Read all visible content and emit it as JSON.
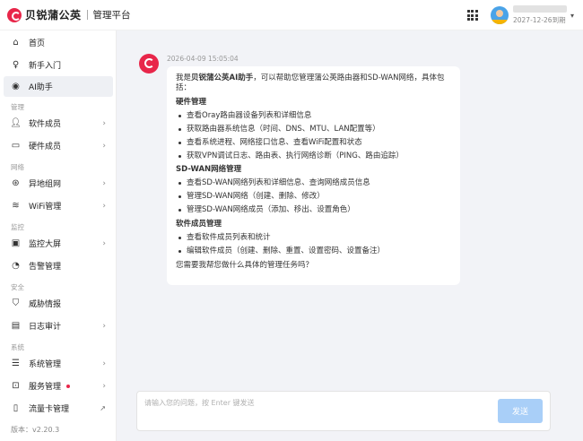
{
  "header": {
    "brand_name": "贝锐蒲公英",
    "brand_sub": "管理平台",
    "user_expire": "2027-12-26到期"
  },
  "sidebar": {
    "items": [
      {
        "label": "首页",
        "icon": "home-icon"
      },
      {
        "label": "新手入门",
        "icon": "bulb-icon"
      },
      {
        "label": "AI助手",
        "icon": "ai-icon"
      }
    ],
    "groups": {
      "manage": "管理",
      "network": "网络",
      "monitor": "监控",
      "security": "安全",
      "system": "系统"
    },
    "manage_items": [
      {
        "label": "软件成员"
      },
      {
        "label": "硬件成员"
      }
    ],
    "network_items": [
      {
        "label": "异地组网"
      },
      {
        "label": "WiFi管理"
      }
    ],
    "monitor_items": [
      {
        "label": "监控大屏"
      },
      {
        "label": "告警管理"
      }
    ],
    "security_items": [
      {
        "label": "威胁情报"
      },
      {
        "label": "日志审计"
      }
    ],
    "system_items": [
      {
        "label": "系统管理"
      },
      {
        "label": "服务管理"
      },
      {
        "label": "流量卡管理"
      }
    ],
    "version": "版本：v2.20.3"
  },
  "chat": {
    "timestamp": "2026-04-09 15:05:04",
    "intro_prefix": "我是",
    "intro_bold": "贝锐蒲公英AI助手",
    "intro_suffix": "，可以帮助您管理蒲公英路由器和SD-WAN网络，具体包括：",
    "sections": [
      {
        "title": "硬件管理",
        "items": [
          "查看Oray路由器设备列表和详细信息",
          "获取路由器系统信息（时间、DNS、MTU、LAN配置等）",
          "查看系统进程、网络接口信息、查看WiFi配置和状态",
          "获取VPN调试日志、路由表、执行网络诊断（PING、路由追踪）"
        ]
      },
      {
        "title": "SD-WAN网络管理",
        "items": [
          "查看SD-WAN网络列表和详细信息、查询网络成员信息",
          "管理SD-WAN网络（创建、删除、修改）",
          "管理SD-WAN网络成员（添加、移出、设置角色）"
        ]
      },
      {
        "title": "软件成员管理",
        "items": [
          "查看软件成员列表和统计",
          "编辑软件成员（创建、删除、重置、设置密码、设置备注）"
        ]
      }
    ],
    "outro": "您需要我帮您做什么具体的管理任务吗？"
  },
  "input": {
    "placeholder": "请输入您的问题，按 Enter 键发送",
    "send_label": "发送"
  },
  "colors": {
    "brand": "#e8264a",
    "send_button": "#a9cff8",
    "main_bg": "#f2f3f7"
  }
}
